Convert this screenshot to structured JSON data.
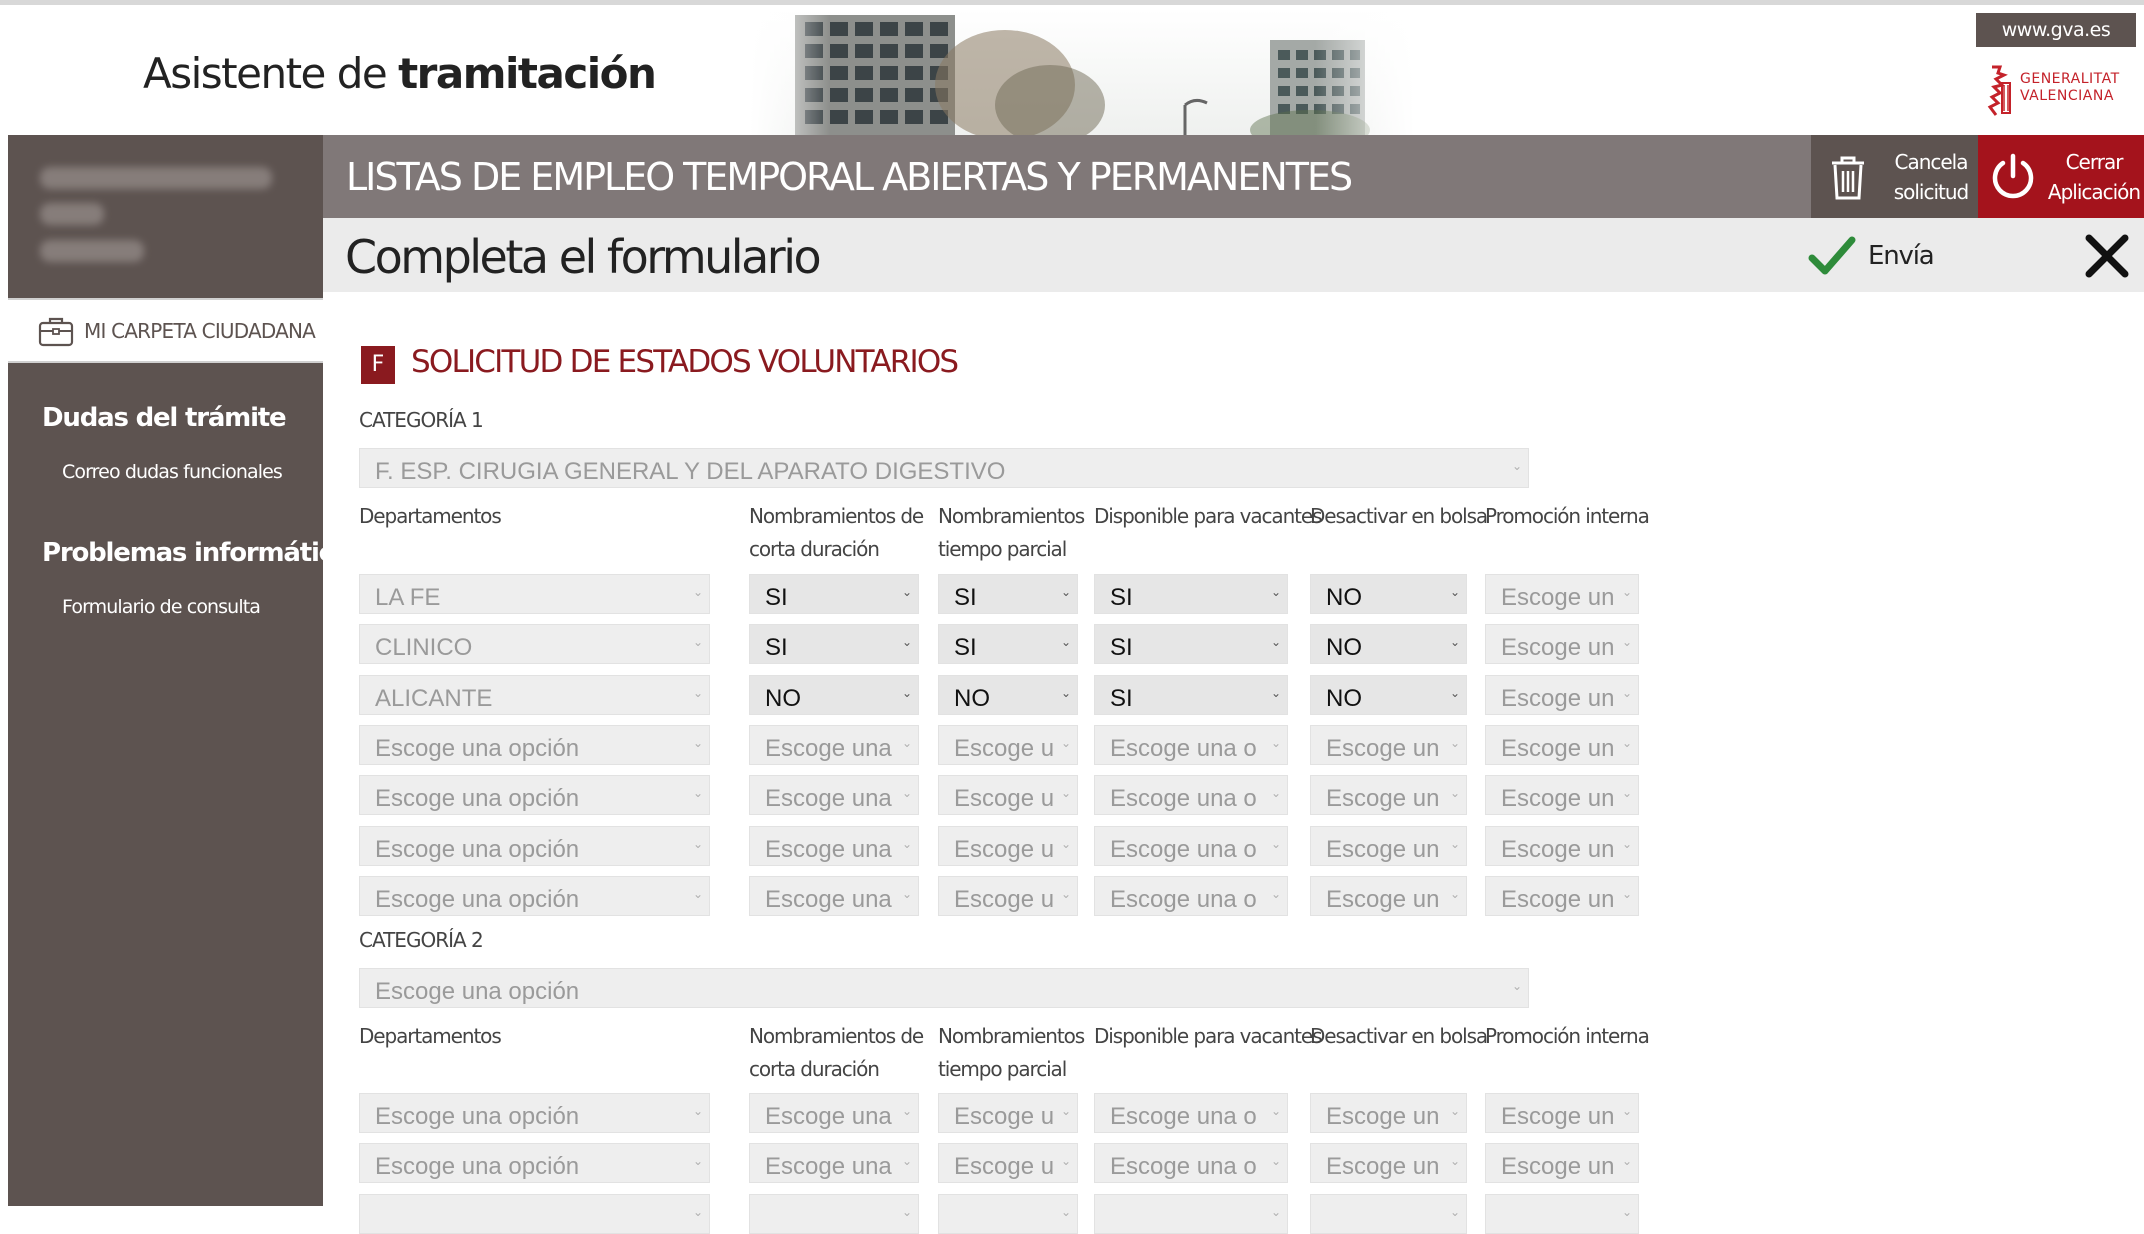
{
  "header": {
    "app_title_prefix": "Asistente de ",
    "app_title_strong": "tramitación",
    "site_link": "www.gva.es",
    "logo_line1": "GENERALITAT",
    "logo_line2": "VALENCIANA"
  },
  "sidebar": {
    "folder_label": "MI CARPETA CIUDADANA",
    "sections": [
      {
        "heading": "Dudas del trámite",
        "link": "Correo dudas funcionales"
      },
      {
        "heading": "Problemas informáticos",
        "link": "Formulario de consulta"
      }
    ]
  },
  "titlebar": {
    "title": "LISTAS DE EMPLEO TEMPORAL ABIERTAS Y PERMANENTES",
    "cancel_line1": "Cancela",
    "cancel_line2": "solicitud",
    "close_line1": "Cerrar",
    "close_line2": "Aplicación"
  },
  "subbar": {
    "title": "Completa el formulario",
    "send_label": "Envía"
  },
  "form": {
    "section_badge": "F",
    "section_title": "SOLICITUD DE ESTADOS VOLUNTARIOS",
    "columns": {
      "departamentos": "Departamentos",
      "corta_1": "Nombramientos de",
      "corta_2": "corta duración",
      "parcial_1": "Nombramientos",
      "parcial_2": "tiempo parcial",
      "vacantes": "Disponible para vacantes",
      "desactivar": "Desactivar en bolsa",
      "promocion": "Promoción interna"
    },
    "cat1": {
      "label": "CATEGORÍA 1",
      "value": "F. ESP. CIRUGIA GENERAL Y DEL APARATO DIGESTIVO",
      "rows": [
        [
          "LA FE",
          "SI",
          "SI",
          "SI",
          "NO",
          "Escoge un"
        ],
        [
          "CLINICO",
          "SI",
          "SI",
          "SI",
          "NO",
          "Escoge un"
        ],
        [
          "ALICANTE",
          "NO",
          "NO",
          "SI",
          "NO",
          "Escoge un"
        ],
        [
          "Escoge una opción",
          "Escoge una",
          "Escoge u",
          "Escoge una o",
          "Escoge un",
          "Escoge un"
        ],
        [
          "Escoge una opción",
          "Escoge una",
          "Escoge u",
          "Escoge una o",
          "Escoge un",
          "Escoge un"
        ],
        [
          "Escoge una opción",
          "Escoge una",
          "Escoge u",
          "Escoge una o",
          "Escoge un",
          "Escoge un"
        ],
        [
          "Escoge una opción",
          "Escoge una",
          "Escoge u",
          "Escoge una o",
          "Escoge un",
          "Escoge un"
        ]
      ]
    },
    "cat2": {
      "label": "CATEGORÍA 2",
      "value": "Escoge una opción",
      "rows": [
        [
          "Escoge una opción",
          "Escoge una",
          "Escoge u",
          "Escoge una o",
          "Escoge un",
          "Escoge un"
        ],
        [
          "Escoge una opción",
          "Escoge una",
          "Escoge u",
          "Escoge una o",
          "Escoge un",
          "Escoge un"
        ],
        [
          "",
          "",
          "",
          "",
          "",
          ""
        ]
      ]
    }
  },
  "colors": {
    "sidebar_bg": "#5d5350",
    "titlebar_bg": "#807878",
    "close_app_bg": "#a4131c",
    "section_color": "#8a1a1f",
    "check_green": "#2e8b3a"
  }
}
